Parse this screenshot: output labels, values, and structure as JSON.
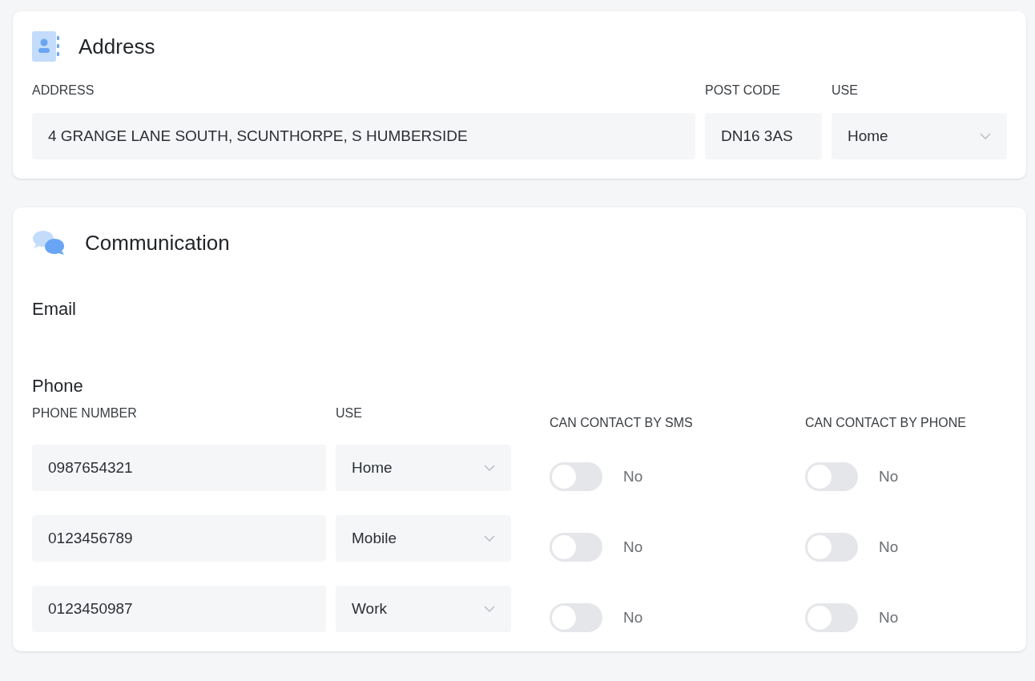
{
  "address_card": {
    "title": "Address",
    "columns": [
      "ADDRESS",
      "POST CODE",
      "USE"
    ],
    "address": "4 GRANGE LANE SOUTH, SCUNTHORPE, S HUMBERSIDE",
    "post_code": "DN16 3AS",
    "use": "Home"
  },
  "communication_card": {
    "title": "Communication",
    "email_heading": "Email",
    "phone_heading": "Phone",
    "columns": [
      "PHONE NUMBER",
      "USE",
      "CAN CONTACT BY SMS",
      "CAN CONTACT BY PHONE"
    ],
    "phones": [
      {
        "number": "0987654321",
        "use": "Home",
        "sms": {
          "on": false,
          "label": "No"
        },
        "phone": {
          "on": false,
          "label": "No"
        }
      },
      {
        "number": "0123456789",
        "use": "Mobile",
        "sms": {
          "on": false,
          "label": "No"
        },
        "phone": {
          "on": false,
          "label": "No"
        }
      },
      {
        "number": "0123450987",
        "use": "Work",
        "sms": {
          "on": false,
          "label": "No"
        },
        "phone": {
          "on": false,
          "label": "No"
        }
      }
    ]
  }
}
